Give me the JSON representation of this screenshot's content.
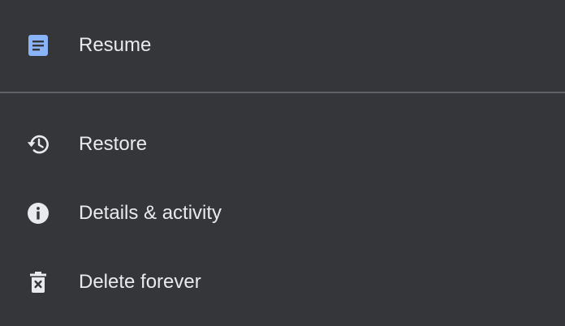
{
  "file": {
    "name": "Resume",
    "icon": "google-docs-icon",
    "icon_color": "#8ab4f8"
  },
  "menu": {
    "restore_label": "Restore",
    "restore_icon": "restore-history-icon",
    "details_label": "Details & activity",
    "details_icon": "info-icon",
    "delete_label": "Delete forever",
    "delete_icon": "delete-forever-icon"
  },
  "colors": {
    "background": "#35363a",
    "text": "#e8eaed",
    "divider": "#5f6368"
  }
}
